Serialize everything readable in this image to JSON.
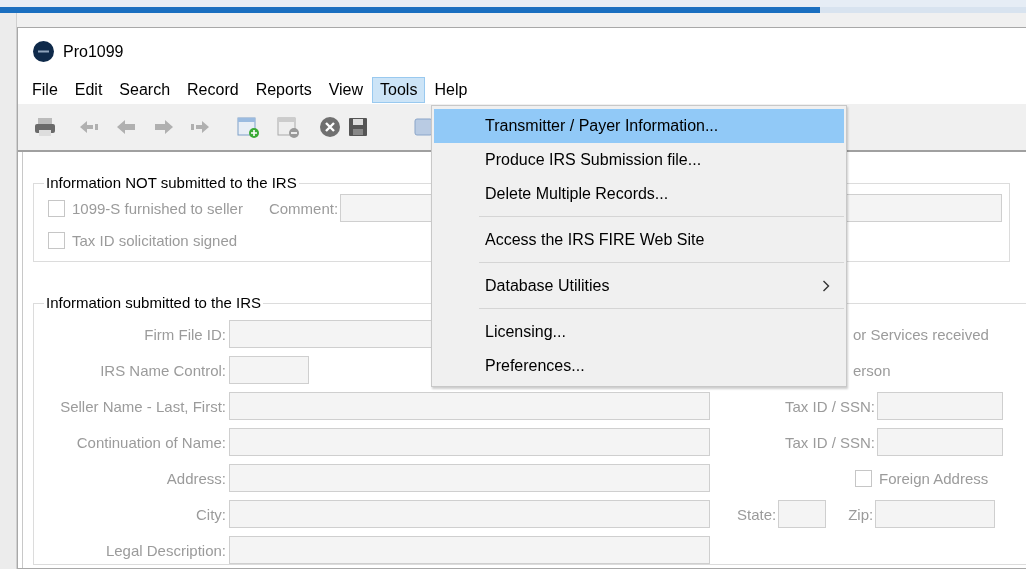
{
  "window": {
    "title": "Pro1099"
  },
  "menu_bar": [
    {
      "label": "File",
      "selected": false
    },
    {
      "label": "Edit",
      "selected": false
    },
    {
      "label": "Search",
      "selected": false
    },
    {
      "label": "Record",
      "selected": false
    },
    {
      "label": "Reports",
      "selected": false
    },
    {
      "label": "View",
      "selected": false
    },
    {
      "label": "Tools",
      "selected": true
    },
    {
      "label": "Help",
      "selected": false
    }
  ],
  "tools_menu": [
    {
      "kind": "item",
      "label": "Transmitter / Payer Information...",
      "selected": true
    },
    {
      "kind": "item",
      "label": "Produce IRS Submission file...",
      "selected": false
    },
    {
      "kind": "item",
      "label": "Delete Multiple Records...",
      "selected": false
    },
    {
      "kind": "separator"
    },
    {
      "kind": "item",
      "label": "Access the IRS FIRE Web Site",
      "selected": false
    },
    {
      "kind": "separator"
    },
    {
      "kind": "submenu",
      "label": "Database Utilities",
      "selected": false
    },
    {
      "kind": "separator"
    },
    {
      "kind": "item",
      "label": "Licensing...",
      "selected": false
    },
    {
      "kind": "item",
      "label": "Preferences...",
      "selected": false
    }
  ],
  "not_submitted": {
    "title": "Information NOT submitted to the IRS",
    "disabled": true,
    "furnished_checkbox": {
      "label": "1099-S furnished to seller",
      "checked": false
    },
    "comment_label": "Comment:",
    "solicitation_checkbox": {
      "label": "Tax ID solicitation signed",
      "checked": false
    }
  },
  "submitted": {
    "title": "Information submitted to the IRS",
    "disabled": true,
    "firm_file_id": "Firm File ID:",
    "services_text": "or Services received",
    "irs_name_control": "IRS Name Control:",
    "person_text": "erson",
    "seller_name": "Seller Name - Last, First:",
    "tax_id_1": "Tax ID / SSN:",
    "continuation": "Continuation of Name:",
    "tax_id_2": "Tax ID / SSN:",
    "address": "Address:",
    "foreign_address": {
      "label": "Foreign Address",
      "checked": false
    },
    "city": "City:",
    "state": "State:",
    "zip": "Zip:",
    "legal_description": "Legal Description:"
  }
}
